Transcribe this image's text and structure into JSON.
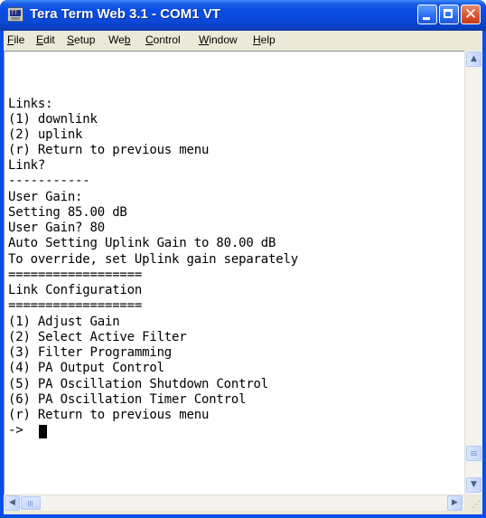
{
  "window": {
    "title": "Tera Term Web 3.1 - COM1 VT",
    "icon": "tera-term-icon",
    "icon_text": "TT"
  },
  "menubar": {
    "items": [
      {
        "label": "File",
        "accel": "F",
        "rest": "ile"
      },
      {
        "label": "Edit",
        "accel": "E",
        "rest": "dit"
      },
      {
        "label": "Setup",
        "accel": "S",
        "rest": "etup"
      },
      {
        "label": "Web",
        "pre": "We",
        "accel": "b"
      },
      {
        "label": "Control",
        "accel": "C",
        "rest": "ontrol"
      },
      {
        "label": "Window",
        "accel": "W",
        "rest": "indow"
      },
      {
        "label": "Help",
        "accel": "H",
        "rest": "elp"
      }
    ]
  },
  "terminal": {
    "lines": [
      "Links:",
      "(1) downlink",
      "(2) uplink",
      "(r) Return to previous menu",
      "Link?",
      "-----------",
      "User Gain:",
      "Setting 85.00 dB",
      "User Gain? 80",
      "Auto Setting Uplink Gain to 80.00 dB",
      "To override, set Uplink gain separately",
      "==================",
      "Link Configuration",
      "==================",
      "(1) Adjust Gain",
      "(2) Select Active Filter",
      "(3) Filter Programming",
      "(4) PA Output Control",
      "(5) PA Oscillation Shutdown Control",
      "(6) PA Oscillation Timer Control",
      "(r) Return to previous menu",
      "->"
    ]
  },
  "colors": {
    "titlebar": "#0a4ee8",
    "terminal_bg": "#ffffff",
    "terminal_fg": "#000000"
  }
}
